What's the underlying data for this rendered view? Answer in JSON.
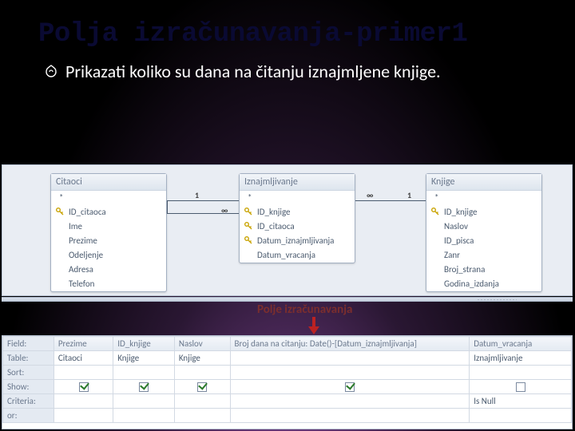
{
  "title": "Polja izračunavanja-primer1",
  "bullet": "Prikazati koliko su dana na čitanju iznajmljene knjige.",
  "annotation": "Polje izračunavanja",
  "tables": {
    "citaoci": {
      "title": "Citaoci",
      "fields": [
        "*",
        "ID_citaoca",
        "Ime",
        "Prezime",
        "Odeljenje",
        "Adresa",
        "Telefon"
      ]
    },
    "iznajmljivanje": {
      "title": "Iznajmljivanje",
      "fields": [
        "*",
        "ID_knjige",
        "ID_citaoca",
        "Datum_iznajmljivanja",
        "Datum_vracanja"
      ]
    },
    "knjige": {
      "title": "Knjige",
      "fields": [
        "*",
        "ID_knjige",
        "Naslov",
        "ID_pisca",
        "Zanr",
        "Broj_strana",
        "Godina_izdanja"
      ]
    }
  },
  "rel": {
    "one": "1",
    "many": "∞"
  },
  "grid": {
    "rows": [
      "Field:",
      "Table:",
      "Sort:",
      "Show:",
      "Criteria:",
      "or:"
    ],
    "cols": [
      {
        "field": "Prezime",
        "table": "Citaoci",
        "show": true,
        "criteria": ""
      },
      {
        "field": "ID_knjige",
        "table": "Knjige",
        "show": true,
        "criteria": ""
      },
      {
        "field": "Naslov",
        "table": "Knjige",
        "show": true,
        "criteria": ""
      },
      {
        "field": "Broj dana na citanju: Date()-[Datum_iznajmljivanja]",
        "table": "",
        "show": true,
        "criteria": ""
      },
      {
        "field": "Datum_vracanja",
        "table": "Iznajmljivanje",
        "show": false,
        "criteria": "Is Null"
      }
    ]
  }
}
